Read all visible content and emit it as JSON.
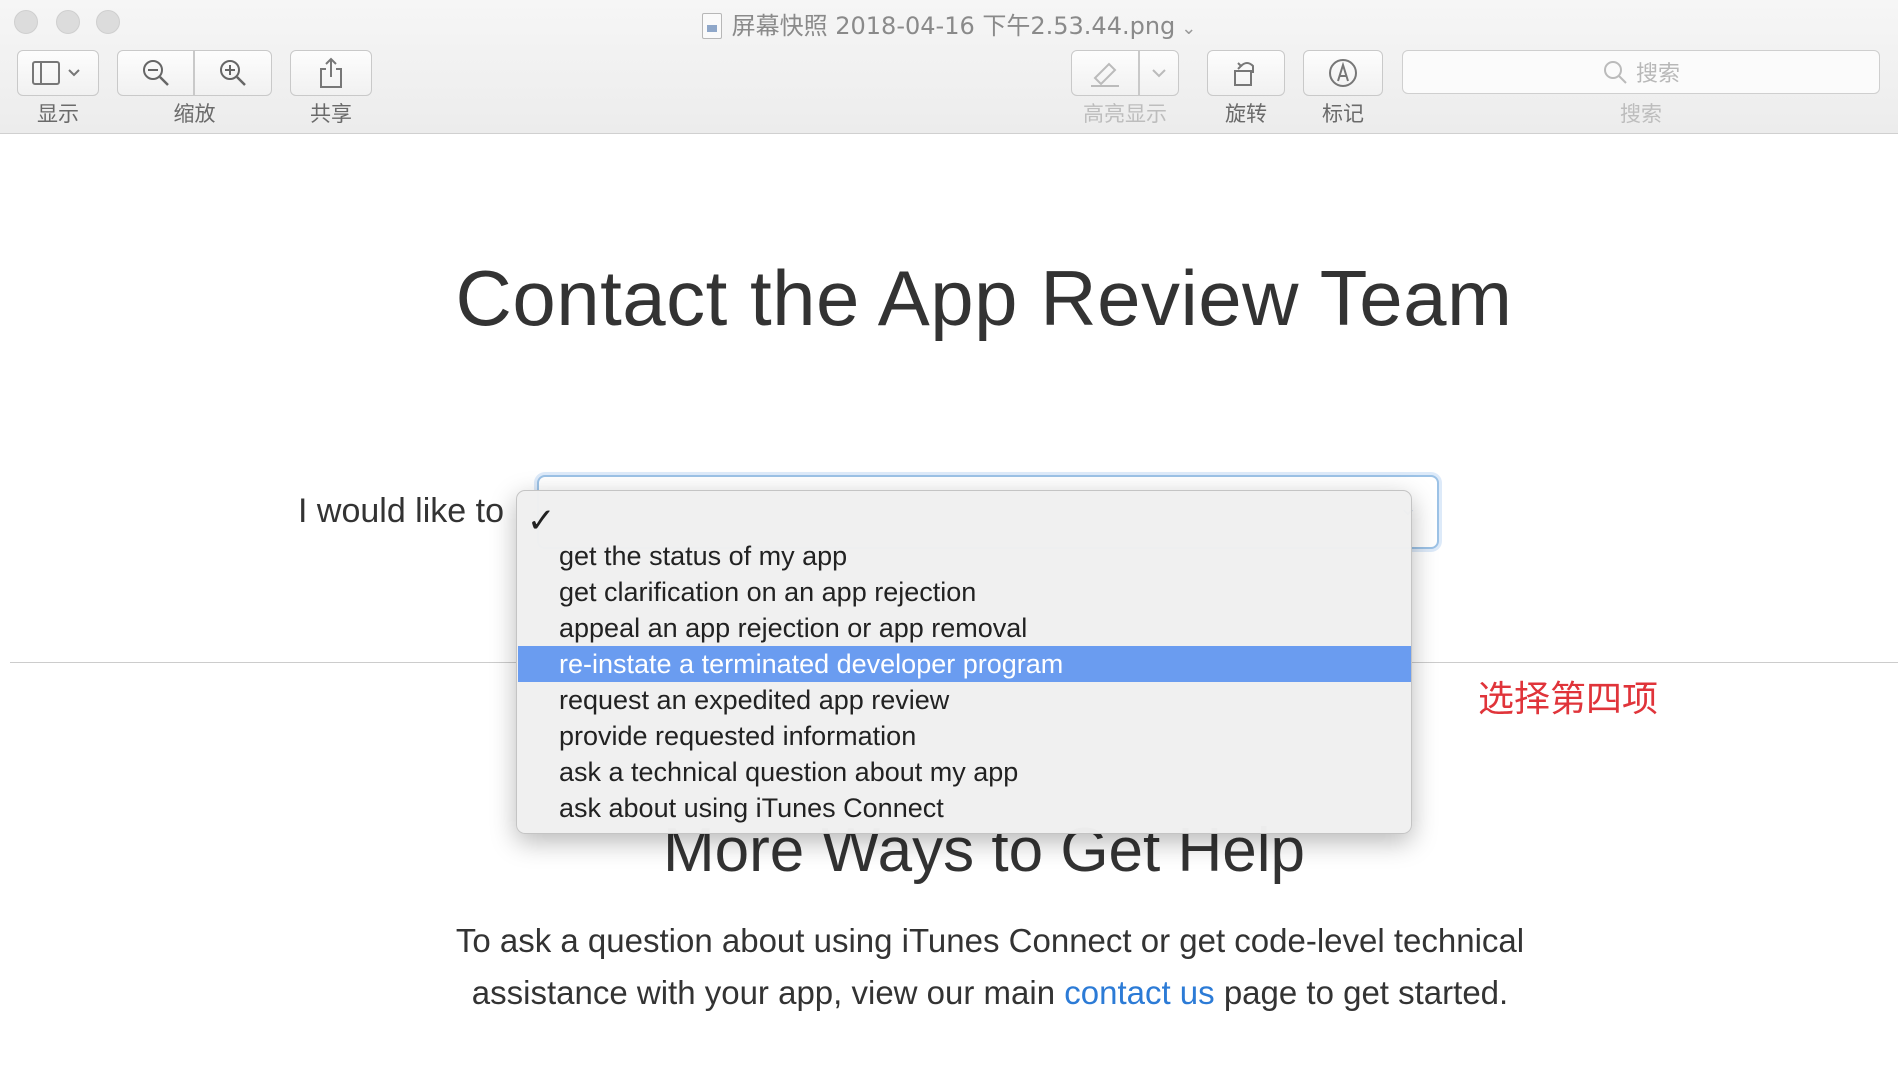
{
  "window": {
    "title": "屏幕快照 2018-04-16 下午2.53.44.png",
    "title_chevron": "⌄"
  },
  "toolbar": {
    "view_label": "显示",
    "zoom_label": "缩放",
    "share_label": "共享",
    "highlight_label": "高亮显示",
    "rotate_label": "旋转",
    "markup_label": "标记",
    "search_placeholder": "搜索",
    "search_label": "搜索"
  },
  "page": {
    "title": "Contact the App Review Team",
    "form_label": "I would like to",
    "select_value": ""
  },
  "dropdown": {
    "check": "✓",
    "options": [
      {
        "label": "get the status of my app"
      },
      {
        "label": "get clarification on an app rejection"
      },
      {
        "label": "appeal an app rejection or app removal"
      },
      {
        "label": "re-instate a terminated developer program",
        "selected": true
      },
      {
        "label": "request an expedited app review"
      },
      {
        "label": "provide requested information"
      },
      {
        "label": "ask a technical question about my app"
      },
      {
        "label": "ask about using iTunes Connect"
      }
    ]
  },
  "annotation": {
    "text": "选择第四项",
    "color": "#e0343a"
  },
  "more_help": {
    "title": "More Ways to Get Help",
    "text_before": "To ask a question about using iTunes Connect or get code-level technical assistance with your app, view our main ",
    "link_text": "contact us",
    "text_after": " page to get started."
  },
  "colors": {
    "selection": "#6a9cf0",
    "link": "#2c7bd6"
  }
}
